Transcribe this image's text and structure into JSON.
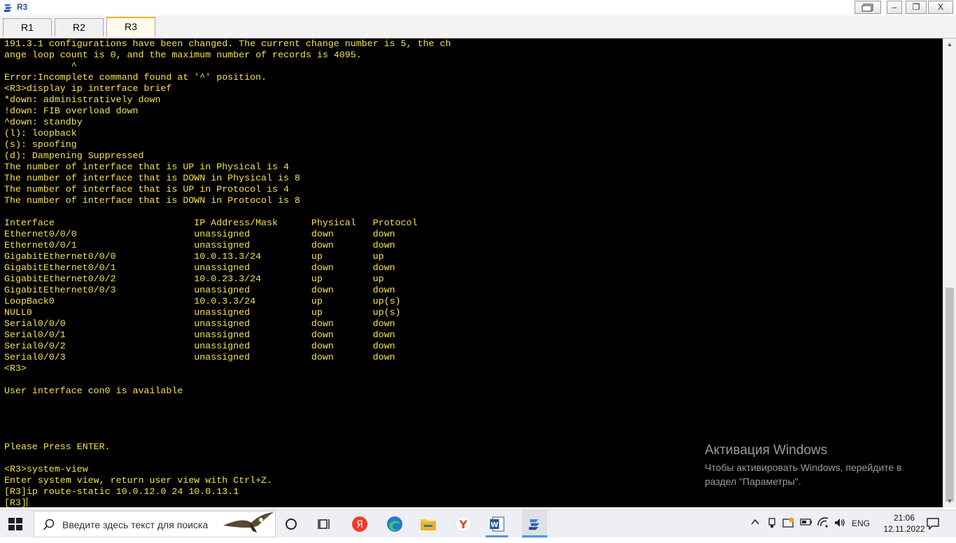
{
  "window": {
    "title": "R3",
    "controls": {
      "restore_big": "",
      "minimize": "–",
      "restore": "❐",
      "close": "X"
    }
  },
  "tabs": [
    {
      "label": "R1",
      "active": false
    },
    {
      "label": "R2",
      "active": false
    },
    {
      "label": "R3",
      "active": true
    }
  ],
  "terminal": {
    "lines": [
      "191.3.1 configurations have been changed. The current change number is 5, the ch",
      "ange loop count is 0, and the maximum number of records is 4095.",
      "            ^",
      "Error:Incomplete command found at '^' position.",
      "<R3>display ip interface brief",
      "*down: administratively down",
      "!down: FIB overload down",
      "^down: standby",
      "(l): loopback",
      "(s): spoofing",
      "(d): Dampening Suppressed",
      "The number of interface that is UP in Physical is 4",
      "The number of interface that is DOWN in Physical is 8",
      "The number of interface that is UP in Protocol is 4",
      "The number of interface that is DOWN in Protocol is 8",
      "",
      "Interface                         IP Address/Mask      Physical   Protocol",
      "Ethernet0/0/0                     unassigned           down       down",
      "Ethernet0/0/1                     unassigned           down       down",
      "GigabitEthernet0/0/0              10.0.13.3/24         up         up",
      "GigabitEthernet0/0/1              unassigned           down       down",
      "GigabitEthernet0/0/2              10.0.23.3/24         up         up",
      "GigabitEthernet0/0/3              unassigned           down       down",
      "LoopBack0                         10.0.3.3/24          up         up(s)",
      "NULL0                             unassigned           up         up(s)",
      "Serial0/0/0                       unassigned           down       down",
      "Serial0/0/1                       unassigned           down       down",
      "Serial0/0/2                       unassigned           down       down",
      "Serial0/0/3                       unassigned           down       down",
      "<R3>",
      "",
      "User interface con0 is available",
      "",
      "",
      "",
      "",
      "Please Press ENTER.",
      "",
      "<R3>system-view",
      "Enter system view, return user view with Ctrl+Z.",
      "[R3]ip route-static 10.0.12.0 24 10.0.13.1",
      "[R3]"
    ],
    "text_color": "#f5e14a",
    "background": "#000000"
  },
  "activation_watermark": {
    "title": "Активация Windows",
    "subtitle": "Чтобы активировать Windows, перейдите в раздел \"Параметры\"."
  },
  "taskbar": {
    "search_placeholder": "Введите здесь текст для поиска",
    "apps": [
      {
        "icon": "cortana-circle-icon"
      },
      {
        "icon": "task-view-icon"
      },
      {
        "icon": "yandex-browser-icon",
        "glyph": "Я"
      },
      {
        "icon": "edge-browser-icon"
      },
      {
        "icon": "file-explorer-icon"
      },
      {
        "icon": "yandex-y-icon",
        "glyph": "Y"
      },
      {
        "icon": "word-icon",
        "glyph": "W"
      },
      {
        "icon": "ensp-icon"
      }
    ],
    "tray_lang": "ENG",
    "time": "21:06",
    "date": "12.11.2022"
  },
  "colors": {
    "accent": "#4c9ae4",
    "tab_active_border": "#f2b233"
  }
}
